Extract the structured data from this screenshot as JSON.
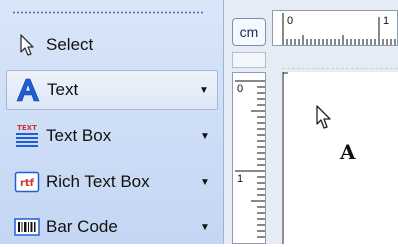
{
  "toolbox": {
    "tools": [
      {
        "label": "Select",
        "icon": "pointer-arrow-icon",
        "has_dropdown": false,
        "selected": false
      },
      {
        "label": "Text",
        "icon": "letter-a-icon",
        "has_dropdown": true,
        "selected": true
      },
      {
        "label": "Text Box",
        "icon": "text-box-icon",
        "has_dropdown": true,
        "selected": false
      },
      {
        "label": "Rich Text Box",
        "icon": "rtf-icon",
        "has_dropdown": true,
        "selected": false
      },
      {
        "label": "Bar Code",
        "icon": "barcode-icon",
        "has_dropdown": true,
        "selected": false
      }
    ]
  },
  "icons_text": {
    "textbox_caption": "TEXT",
    "rtf_caption": "rtf"
  },
  "units_button": {
    "label": "cm"
  },
  "rulers": {
    "horizontal_labels": [
      "0",
      "1"
    ],
    "vertical_labels": [
      "0",
      "1"
    ]
  },
  "canvas": {
    "cursor_letter": "A"
  },
  "colors": {
    "toolbox_bg": "#c4d6f3",
    "accent_blue": "#1f5fd6",
    "rtf_red": "#d0302a"
  }
}
